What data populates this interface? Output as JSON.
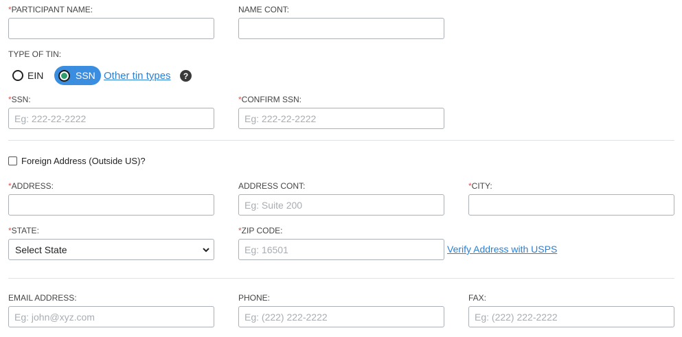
{
  "participant": {
    "name_label": "PARTICIPANT NAME:",
    "name_cont_label": "NAME CONT:"
  },
  "tin": {
    "label": "TYPE OF TIN:",
    "options": [
      "EIN",
      "SSN"
    ],
    "selected": "SSN",
    "other_link": "Other tin types",
    "help_glyph": "?"
  },
  "ssn": {
    "ssn_label": "SSN:",
    "ssn_placeholder": "Eg: 222-22-2222",
    "confirm_label": "CONFIRM SSN:",
    "confirm_placeholder": "Eg: 222-22-2222"
  },
  "foreign": {
    "label": "Foreign Address (Outside US)?",
    "checked": false
  },
  "address": {
    "address_label": "ADDRESS:",
    "address_cont_label": "ADDRESS CONT:",
    "address_cont_placeholder": "Eg: Suite 200",
    "city_label": "CITY:",
    "state_label": "STATE:",
    "state_selected": "Select State",
    "zip_label": "ZIP CODE:",
    "zip_placeholder": "Eg: 16501",
    "verify_link": "Verify Address with USPS"
  },
  "contact": {
    "email_label": "EMAIL ADDRESS:",
    "email_placeholder": "Eg: john@xyz.com",
    "phone_label": "PHONE:",
    "phone_placeholder": "Eg: (222) 222-2222",
    "fax_label": "FAX:",
    "fax_placeholder": "Eg: (222) 222-2222"
  },
  "required_marker": "*",
  "colors": {
    "accent": "#3b8de0",
    "link": "#2a7fd4",
    "required": "#d9534f",
    "border": "#aab0b6"
  }
}
